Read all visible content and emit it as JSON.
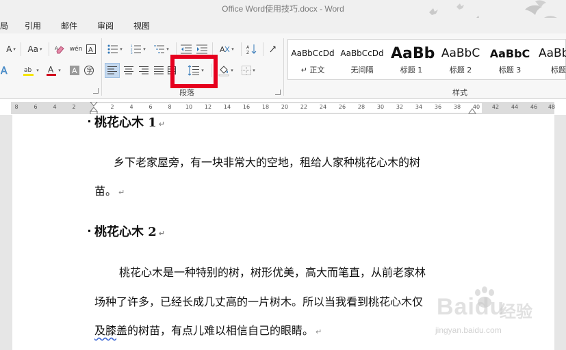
{
  "window": {
    "title": "Office Word使用技巧.docx - Word"
  },
  "tabs": [
    "局",
    "引用",
    "邮件",
    "审阅",
    "视图"
  ],
  "ribbon": {
    "font_group": {
      "font_size_label": "A",
      "change_case_label": "Aa",
      "phonetic_label": "wén"
    },
    "paragraph_group": {
      "label": "段落"
    },
    "styles_group": {
      "label": "样式",
      "items": [
        {
          "sample": "AaBbCcDd",
          "name": "↵ 正文"
        },
        {
          "sample": "AaBbCcDd",
          "name": "无间隔"
        },
        {
          "sample": "AaBb",
          "name": "标题 1"
        },
        {
          "sample": "AaBbC",
          "name": "标题 2"
        },
        {
          "sample": "AaBbC",
          "name": "标题 3"
        },
        {
          "sample": "AaBb",
          "name": "标题"
        }
      ]
    }
  },
  "ruler": {
    "ticks": [
      "8",
      "6",
      "4",
      "2",
      "2",
      "4",
      "6",
      "8",
      "10",
      "12",
      "14",
      "16",
      "18",
      "20",
      "22",
      "24",
      "26",
      "28",
      "30",
      "32",
      "34",
      "36",
      "38",
      "40",
      "42",
      "44",
      "46",
      "48"
    ]
  },
  "document": {
    "heading1": "桃花心木 1",
    "para1_line1": "乡下老家屋旁，有一块非常大的空地，租给人家种桃花心木的树",
    "para1_line2": "苗。",
    "heading2": "桃花心木 2",
    "para2_line1": "桃花心木是一种特别的树，树形优美，高大而笔直，从前老家林",
    "para2_line2": "场种了许多，已经长成几丈高的一片树木。所以当我看到桃花心木仅",
    "para2_line3_word": "及膝",
    "para2_line3_rest": "盖的树苗，有点儿难以相信自己的眼睛。",
    "para_mark": "↵"
  },
  "watermark": {
    "brand": "Baidu",
    "brand_cn": "经验",
    "url": "jingyan.baidu.com"
  },
  "colors": {
    "highlight_box": "#e6001e",
    "font_color_bar": "#d0021b",
    "highlighter_bar": "#f5e400",
    "active_button": "#c5d9ef"
  }
}
